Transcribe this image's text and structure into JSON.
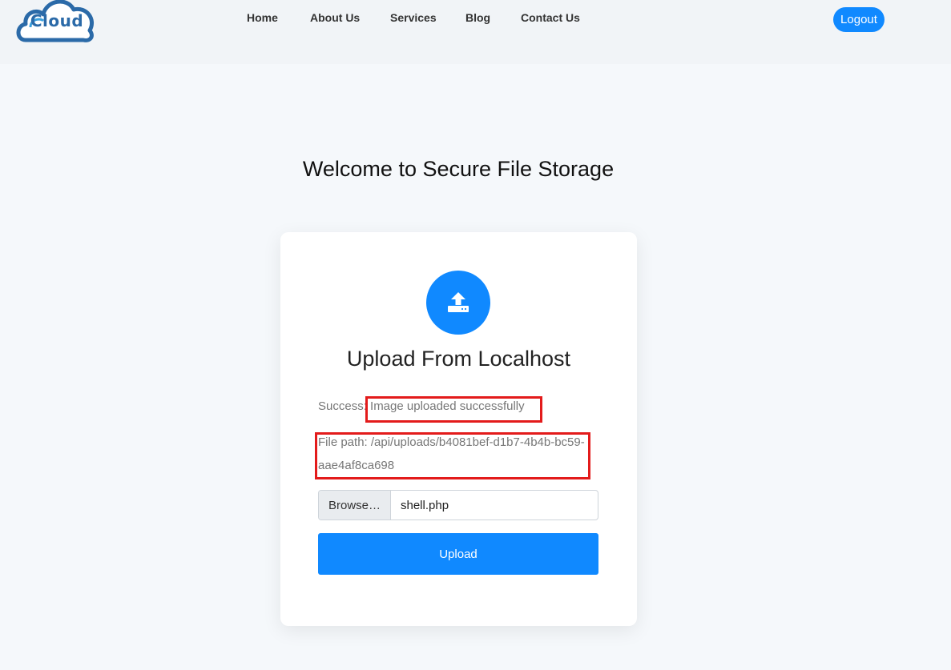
{
  "brand": {
    "logo_text": "Cloud"
  },
  "nav": {
    "items": [
      {
        "label": "Home"
      },
      {
        "label": "About Us"
      },
      {
        "label": "Services"
      },
      {
        "label": "Blog"
      },
      {
        "label": "Contact Us"
      }
    ],
    "logout_label": "Logout"
  },
  "main": {
    "title": "Welcome to Secure File Storage",
    "card": {
      "upload_icon": "upload-icon",
      "title": "Upload From Localhost",
      "success_text": "Success: Image uploaded successfully",
      "file_path_text": "File path: /api/uploads/b4081bef-d1b7-4b4b-bc59-aae4af8ca698",
      "browse_label": "Browse…",
      "file_name": "shell.php",
      "upload_label": "Upload"
    }
  },
  "colors": {
    "accent": "#1089ff",
    "highlight_box": "#e31b1b",
    "background": "#f5f8fb",
    "header_bg": "#f1f4f7"
  }
}
